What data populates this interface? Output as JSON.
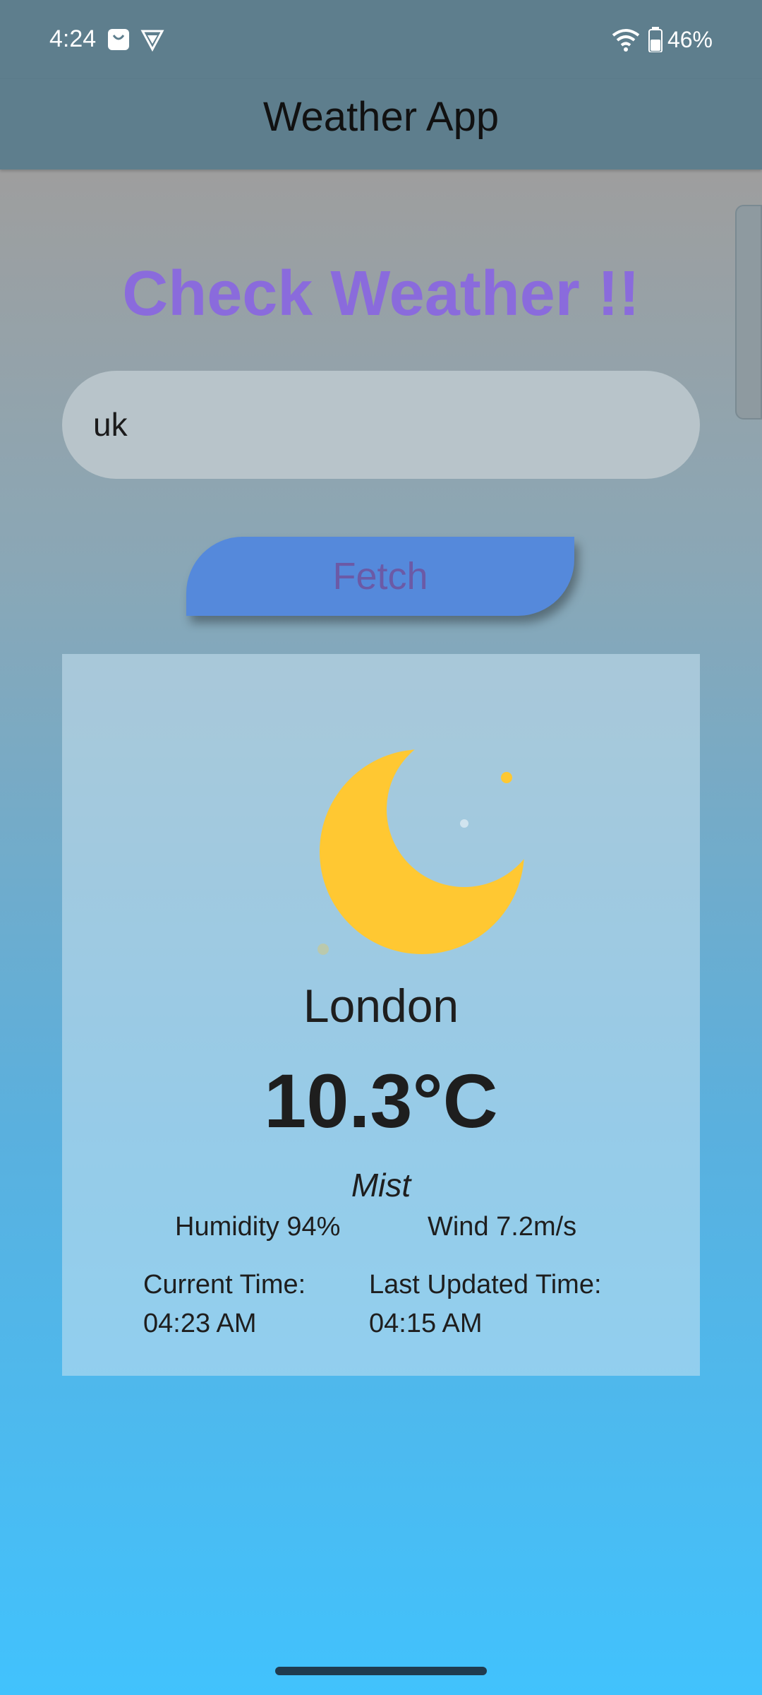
{
  "status_bar": {
    "time": "4:24",
    "battery": "46%",
    "icons": [
      "shopping-bag-icon",
      "vpn-shield-icon",
      "wifi-icon",
      "battery-icon"
    ]
  },
  "app_bar": {
    "title": "Weather App"
  },
  "main": {
    "headline": "Check Weather !!",
    "search_value": "uk",
    "fetch_label": "Fetch"
  },
  "weather": {
    "icon": "moon-icon",
    "city": "London",
    "temperature": "10.3°C",
    "condition": "Mist",
    "humidity": "Humidity 94%",
    "wind": "Wind 7.2m/s",
    "current_time_label": "Current Time:",
    "current_time_value": "04:23 AM",
    "last_updated_label": "Last Updated Time:",
    "last_updated_value": "04:15 AM"
  },
  "colors": {
    "app_bar": "#5e7e8d",
    "headline": "#8a6bdc",
    "button": "#5589db",
    "button_text": "#6b5aa6",
    "moon": "#ffc832"
  }
}
